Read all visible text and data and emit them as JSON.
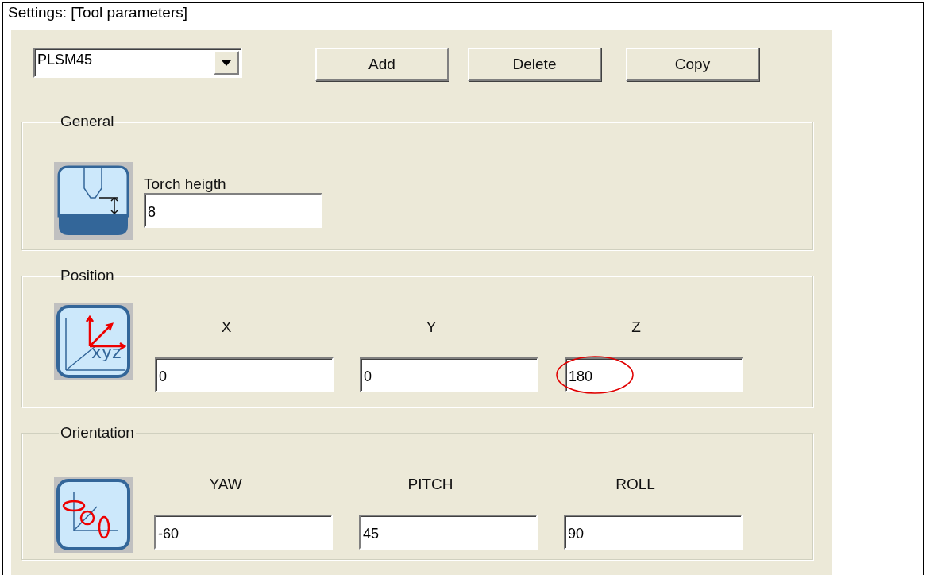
{
  "window": {
    "title": "Settings: [Tool parameters]"
  },
  "tool_select": {
    "value": "PLSM45"
  },
  "buttons": [
    "Add",
    "Delete",
    "Copy"
  ],
  "groups": [
    {
      "title": "General",
      "kind": "torch",
      "fields": [
        {
          "label": "Torch heigth",
          "value": "8",
          "highlighted": false
        }
      ]
    },
    {
      "title": "Position",
      "kind": "position",
      "icon_text": "xyz",
      "fields": [
        {
          "label": "X",
          "value": "0",
          "highlighted": false
        },
        {
          "label": "Y",
          "value": "0",
          "highlighted": false
        },
        {
          "label": "Z",
          "value": "180",
          "highlighted": true
        }
      ]
    },
    {
      "title": "Orientation",
      "kind": "orientation",
      "fields": [
        {
          "label": "YAW",
          "value": "-60",
          "highlighted": false
        },
        {
          "label": "PITCH",
          "value": "45",
          "highlighted": false
        },
        {
          "label": "ROLL",
          "value": "90",
          "highlighted": false
        }
      ]
    }
  ]
}
